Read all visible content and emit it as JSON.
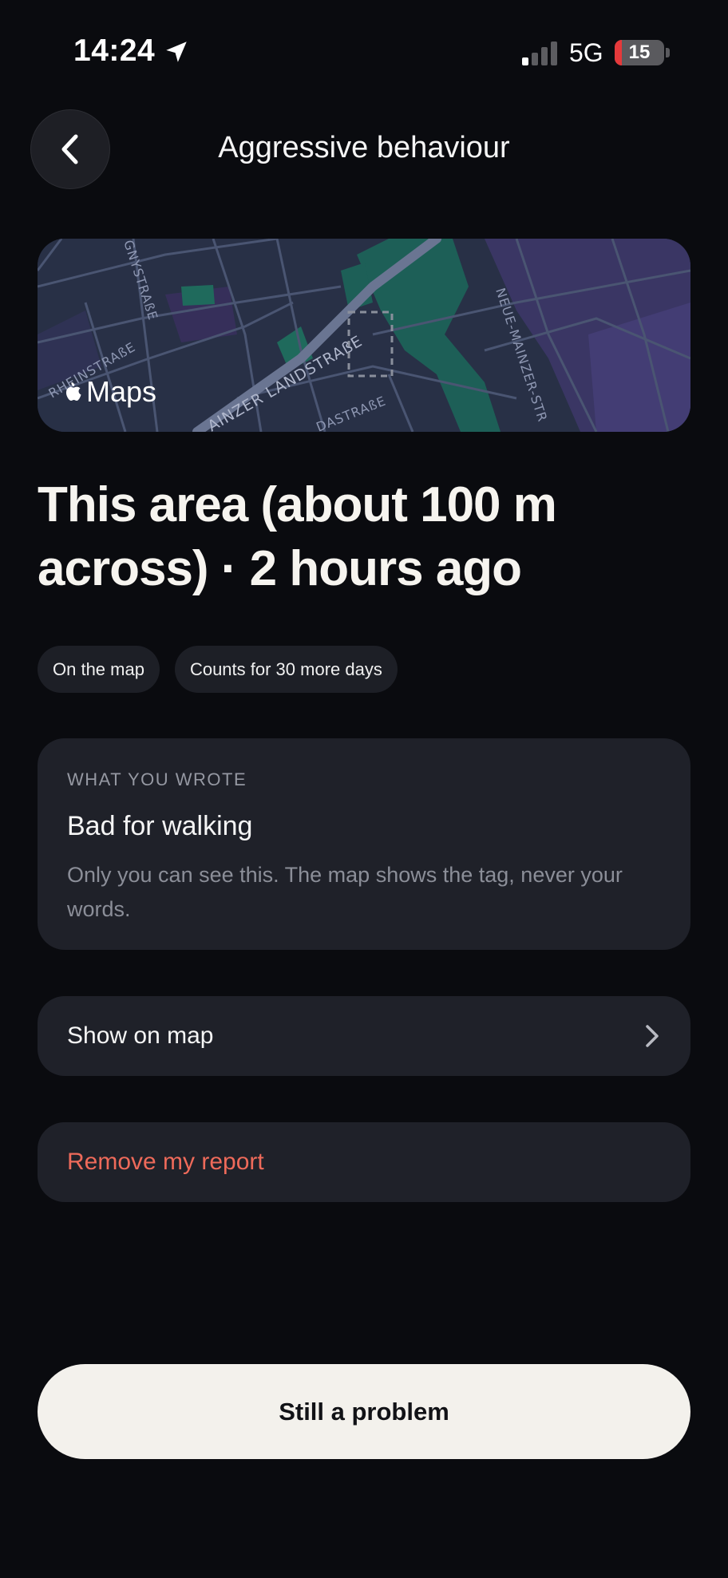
{
  "status_bar": {
    "time": "14:24",
    "network": "5G",
    "battery_level": "15",
    "battery_fraction": 0.15,
    "location_icon": "location-arrow-icon",
    "signal_icon": "cellular-signal-icon"
  },
  "header": {
    "title": "Aggressive behaviour",
    "back_icon": "chevron-left-icon"
  },
  "map_preview": {
    "attribution": "Maps",
    "street_labels": [
      "RHEINSTRAßE",
      "GNYSTRAßE",
      "AINZER LANDSTRAßE",
      "DASTRAßE",
      "NEUE-MAINZER-STR"
    ]
  },
  "report": {
    "headline": "This area (about 100 m across) · 2 hours ago",
    "chips": [
      "On the map",
      "Counts for 30 more days"
    ]
  },
  "note": {
    "label": "WHAT YOU WROTE",
    "text": "Bad for walking",
    "hint": "Only you can see this. The map shows the tag, never your words."
  },
  "actions": {
    "show_on_map": "Show on map",
    "remove_report": "Remove my report",
    "primary": "Still a problem"
  },
  "colors": {
    "background": "#0a0b0f",
    "card": "#1f2129",
    "destructive": "#ee6a5a",
    "primary_button": "#f3f1ec",
    "battery_low": "#e5393b"
  }
}
